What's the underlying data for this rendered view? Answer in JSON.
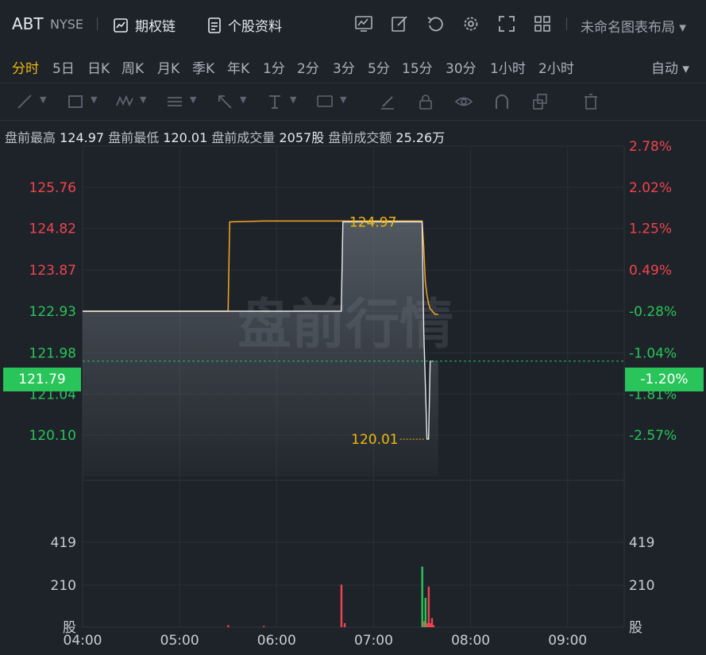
{
  "header": {
    "symbol": "ABT",
    "exchange": "NYSE",
    "options_chain": "期权链",
    "stock_profile": "个股资料",
    "layout_name": "未命名图表布局"
  },
  "periods": [
    "分时",
    "5日",
    "日K",
    "周K",
    "月K",
    "季K",
    "年K",
    "1分",
    "2分",
    "3分",
    "5分",
    "15分",
    "30分",
    "1小时",
    "2小时"
  ],
  "active_period": "分时",
  "auto_label": "自动",
  "stats": {
    "high_label": "盘前最高",
    "high_value": "124.97",
    "low_label": "盘前最低",
    "low_value": "120.01",
    "vol_label": "盘前成交量",
    "vol_value": "2057股",
    "amt_label": "盘前成交额",
    "amt_value": "25.26万"
  },
  "watermark": "盘前行情",
  "colors": {
    "up": "#f0444f",
    "down": "#29c45a",
    "accent": "#f0b90b",
    "line": "#f5a623"
  },
  "chart_data": {
    "type": "line",
    "price_axis_left": [
      "125.76",
      "124.82",
      "123.87",
      "122.93",
      "121.98",
      "121.04",
      "120.10"
    ],
    "price_axis_right": [
      "2.78%",
      "2.02%",
      "1.25%",
      "0.49%",
      "-0.28%",
      "-1.04%",
      "-1.81%",
      "-2.57%"
    ],
    "last_price": "121.79",
    "last_pct": "-1.20%",
    "high_marker": "124.97",
    "low_marker": "120.01",
    "time_axis": [
      "04:00",
      "05:00",
      "06:00",
      "07:00",
      "08:00",
      "09:00"
    ],
    "volume_axis": [
      "419",
      "210",
      "股"
    ],
    "series": [
      {
        "x": [
          "04:00",
          "05:30",
          "05:31",
          "05:52",
          "06:40",
          "06:41",
          "07:30",
          "07:31",
          "07:32",
          "07:33",
          "07:34",
          "07:35",
          "07:36",
          "07:37",
          "07:38",
          "07:40"
        ],
        "values": [
          122.93,
          122.93,
          124.97,
          124.99,
          124.99,
          124.99,
          124.99,
          124.4,
          123.6,
          123.3,
          123.1,
          122.98,
          122.95,
          122.9,
          122.86,
          122.86
        ]
      },
      {
        "x": [
          "04:00",
          "06:40",
          "06:41",
          "07:30",
          "07:31",
          "07:33",
          "07:34",
          "07:35",
          "07:36",
          "07:37"
        ],
        "values": [
          122.93,
          122.93,
          124.97,
          124.97,
          122.5,
          120.01,
          120.01,
          121.79,
          121.79,
          121.79
        ]
      }
    ],
    "volume": [
      {
        "x": "05:30",
        "v": 10,
        "dir": "up"
      },
      {
        "x": "05:52",
        "v": 6,
        "dir": "up"
      },
      {
        "x": "06:40",
        "v": 210,
        "dir": "up"
      },
      {
        "x": "06:42",
        "v": 20,
        "dir": "up"
      },
      {
        "x": "07:30",
        "v": 299,
        "dir": "down"
      },
      {
        "x": "07:31",
        "v": 30,
        "dir": "up"
      },
      {
        "x": "07:32",
        "v": 145,
        "dir": "down"
      },
      {
        "x": "07:33",
        "v": 20,
        "dir": "up"
      },
      {
        "x": "07:34",
        "v": 200,
        "dir": "up"
      },
      {
        "x": "07:35",
        "v": 20,
        "dir": "up"
      },
      {
        "x": "07:36",
        "v": 45,
        "dir": "up"
      },
      {
        "x": "07:37",
        "v": 10,
        "dir": "up"
      }
    ]
  }
}
